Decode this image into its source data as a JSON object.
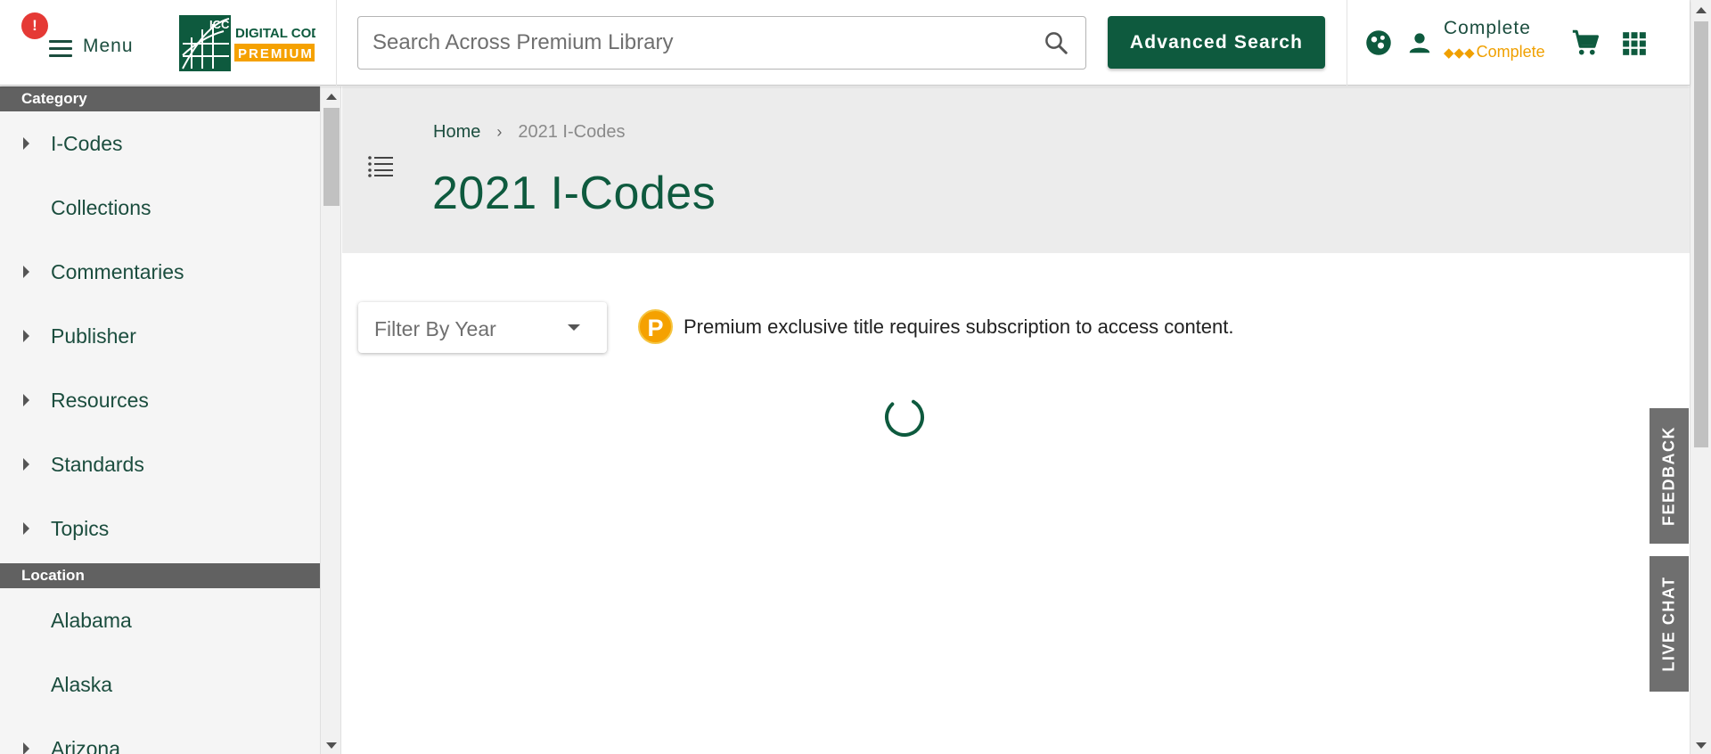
{
  "header": {
    "alert_badge": "!",
    "menu_label": "Menu",
    "logo": {
      "left_text": "ICC",
      "right_line1": "DIGITAL CODES",
      "right_line2": "PREMIUM"
    },
    "search": {
      "placeholder": "Search Across Premium Library",
      "icon": "search-icon"
    },
    "advanced_search_label": "Advanced Search",
    "icons": [
      "community-icon",
      "user-icon",
      "cart-icon",
      "apps-grid-icon"
    ],
    "account": {
      "title": "Complete",
      "subtitle": "Complete",
      "diamonds": "◆◆◆"
    }
  },
  "sidebar": {
    "category_header": "Category",
    "category_items": [
      {
        "label": "I-Codes",
        "expandable": true
      },
      {
        "label": "Collections",
        "expandable": false
      },
      {
        "label": "Commentaries",
        "expandable": true
      },
      {
        "label": "Publisher",
        "expandable": true
      },
      {
        "label": "Resources",
        "expandable": true
      },
      {
        "label": "Standards",
        "expandable": true
      },
      {
        "label": "Topics",
        "expandable": true
      }
    ],
    "location_header": "Location",
    "location_items": [
      {
        "label": "Alabama",
        "expandable": false
      },
      {
        "label": "Alaska",
        "expandable": false
      },
      {
        "label": "Arizona",
        "expandable": true
      }
    ]
  },
  "main": {
    "breadcrumb": {
      "home": "Home",
      "separator": "›",
      "current": "2021 I-Codes"
    },
    "title": "2021 I-Codes",
    "filter_label": "Filter By Year",
    "premium_badge": "P",
    "premium_note": "Premium exclusive title requires subscription to access content."
  },
  "side_tabs": {
    "feedback": "FEEDBACK",
    "live_chat": "LIVE CHAT"
  },
  "colors": {
    "brand_green": "#0e5a3e",
    "text_green": "#1b4d3e",
    "premium_orange": "#f5a100",
    "alert_red": "#e53935",
    "sidebar_header_bg": "#616161",
    "hero_bg": "#ececec"
  }
}
